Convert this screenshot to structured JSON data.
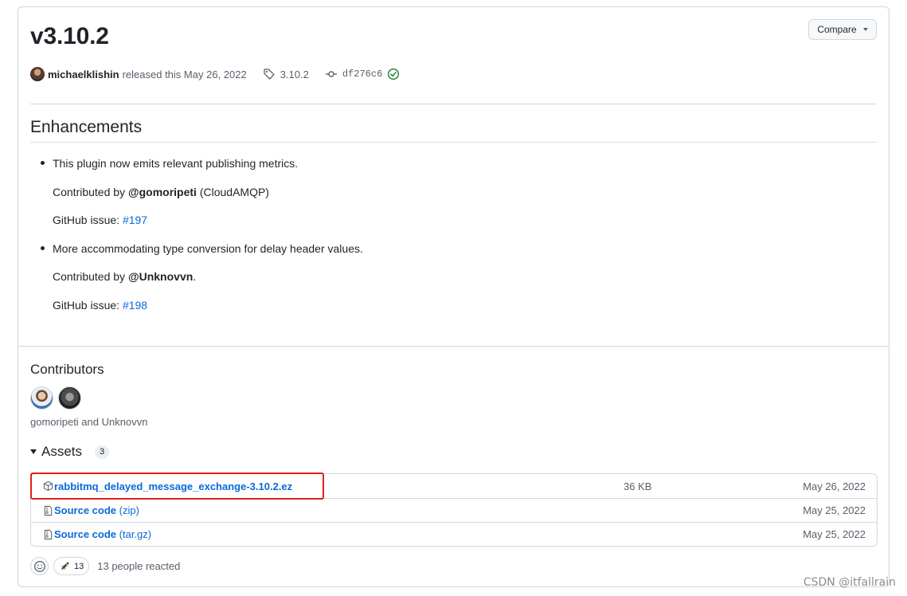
{
  "release": {
    "title": "v3.10.2",
    "compare_label": "Compare",
    "author": "michaelklishin",
    "released_text": "released this May 26, 2022",
    "tag": "3.10.2",
    "commit": "df276c6"
  },
  "notes": {
    "heading": "Enhancements",
    "items": [
      {
        "text": "This plugin now emits relevant publishing metrics.",
        "contributed_prefix": "Contributed by ",
        "contributor": "@gomoripeti",
        "contributed_suffix": " (CloudAMQP)",
        "issue_prefix": "GitHub issue: ",
        "issue": "#197"
      },
      {
        "text": "More accommodating type conversion for delay header values.",
        "contributed_prefix": "Contributed by ",
        "contributor": "@Unknovvn",
        "contributed_suffix": ".",
        "issue_prefix": "GitHub issue: ",
        "issue": "#198"
      }
    ]
  },
  "contributors": {
    "heading": "Contributors",
    "names": "gomoripeti and Unknovvn"
  },
  "assets": {
    "heading": "Assets",
    "count": "3",
    "rows": [
      {
        "icon": "package-icon",
        "name": "rabbitmq_delayed_message_exchange-3.10.2.ez",
        "sub": "",
        "size": "36 KB",
        "date": "May 26, 2022"
      },
      {
        "icon": "file-zip-icon",
        "name": "Source code",
        "sub": " (zip)",
        "size": "",
        "date": "May 25, 2022"
      },
      {
        "icon": "file-zip-icon",
        "name": "Source code",
        "sub": " (tar.gz)",
        "size": "",
        "date": "May 25, 2022"
      }
    ]
  },
  "reactions": {
    "rocket_count": "13",
    "summary": "13 people reacted"
  },
  "watermark": "CSDN @itfallrain",
  "colors": {
    "link": "#0969da",
    "verified": "#1a7f37",
    "highlight": "#e0201a"
  }
}
